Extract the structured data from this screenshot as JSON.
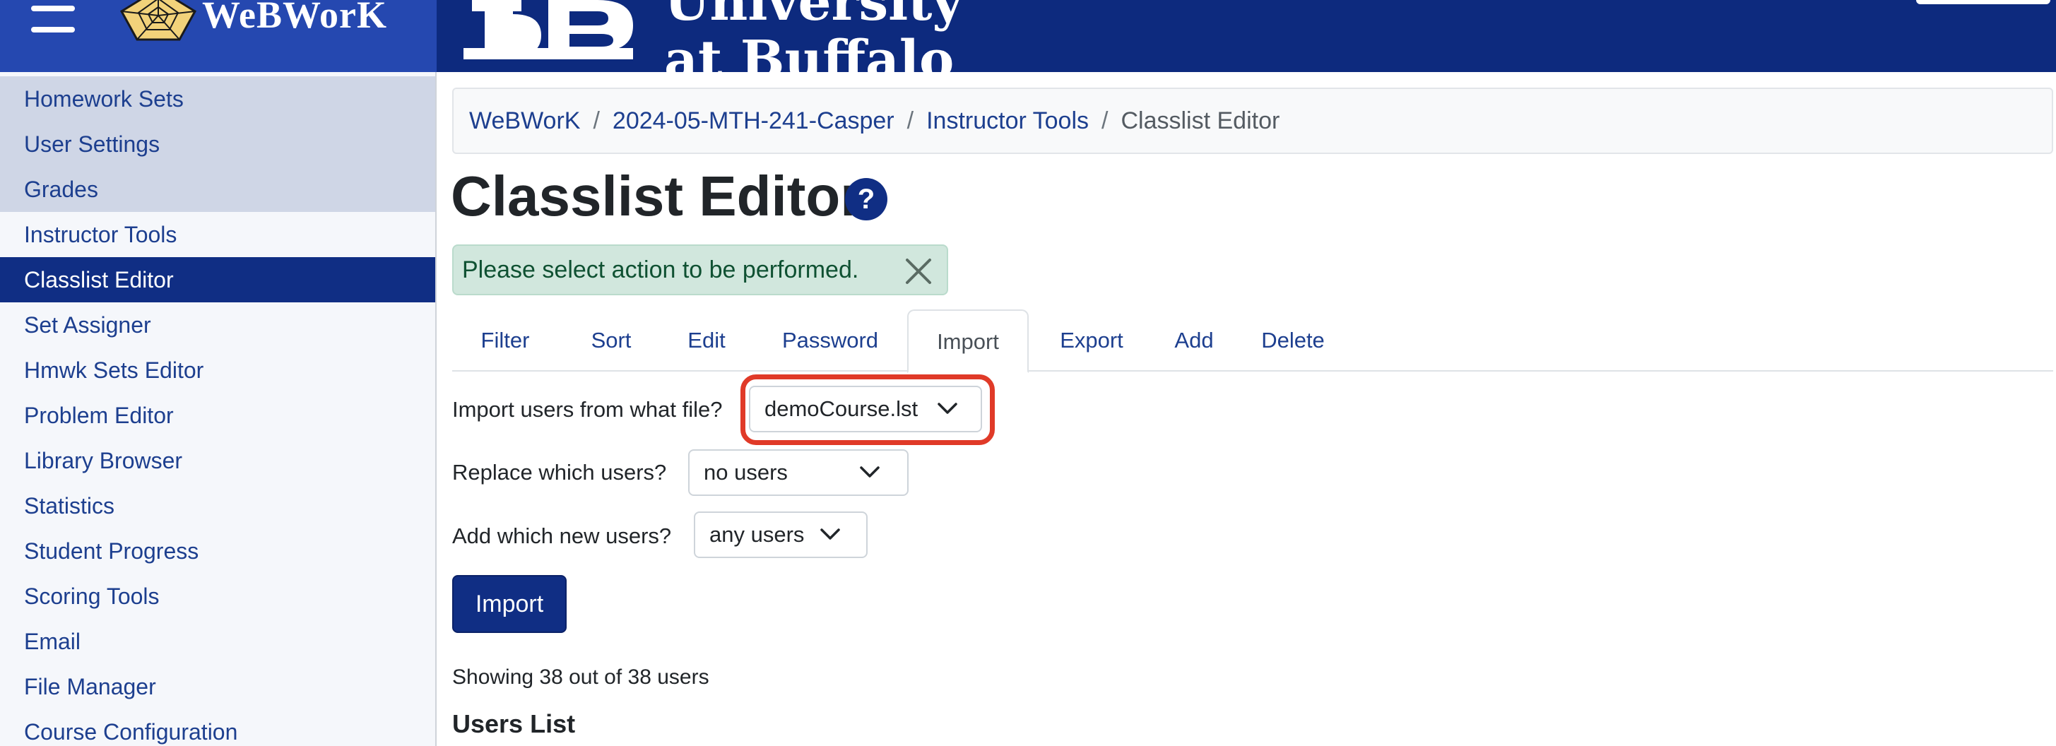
{
  "header": {
    "logo_text": "WeBWorK",
    "university_line1": "University",
    "university_line2": "at Buffalo"
  },
  "sidebar": {
    "items": [
      {
        "label": "Homework Sets"
      },
      {
        "label": "User Settings"
      },
      {
        "label": "Grades"
      },
      {
        "label": "Instructor Tools"
      },
      {
        "label": "Classlist Editor"
      },
      {
        "label": "Set Assigner"
      },
      {
        "label": "Hmwk Sets Editor"
      },
      {
        "label": "Problem Editor"
      },
      {
        "label": "Library Browser"
      },
      {
        "label": "Statistics"
      },
      {
        "label": "Student Progress"
      },
      {
        "label": "Scoring Tools"
      },
      {
        "label": "Email"
      },
      {
        "label": "File Manager"
      },
      {
        "label": "Course Configuration"
      }
    ],
    "active_index": 4
  },
  "breadcrumb": {
    "items": [
      "WeBWorK",
      "2024-05-MTH-241-Casper",
      "Instructor Tools"
    ],
    "current": "Classlist Editor",
    "separator": "/"
  },
  "page": {
    "title": "Classlist Editor",
    "help_symbol": "?"
  },
  "alert": {
    "message": "Please select action to be performed."
  },
  "tabs": {
    "items": [
      "Filter",
      "Sort",
      "Edit",
      "Password",
      "Import",
      "Export",
      "Add",
      "Delete"
    ],
    "active": "Import"
  },
  "form": {
    "file_label": "Import users from what file?",
    "file_value": "demoCourse.lst",
    "replace_label": "Replace which users?",
    "replace_value": "no users",
    "add_label": "Add which new users?",
    "add_value": "any users",
    "submit_label": "Import"
  },
  "status": {
    "showing": "Showing 38 out of 38 users",
    "users_list_heading": "Users List"
  },
  "colors": {
    "header_bg": "#0d2a7e",
    "header_left_bg": "#2548b0",
    "primary": "#102e84",
    "link": "#1d3f8f",
    "highlight": "#e03a28",
    "alert_bg": "#d1e7dd"
  }
}
